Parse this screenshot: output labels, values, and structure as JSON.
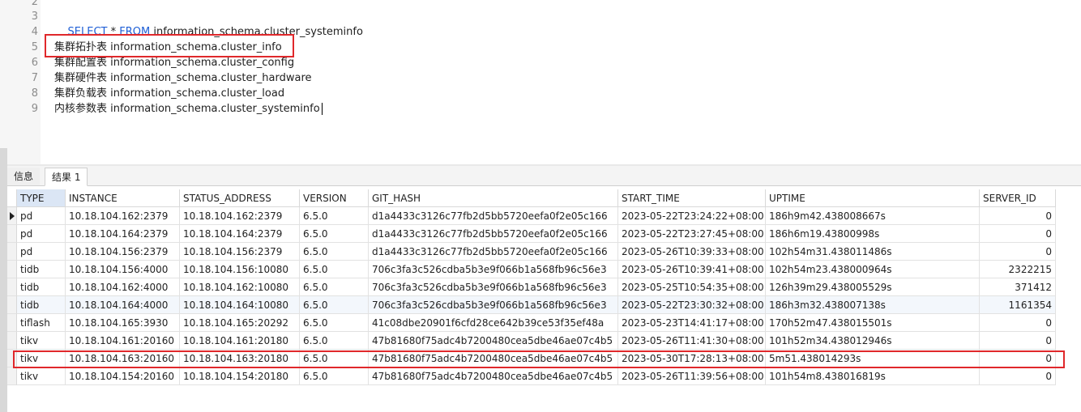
{
  "editor": {
    "lines": [
      {
        "num": "2",
        "text": ""
      },
      {
        "num": "3",
        "kw1": "SELECT",
        "mid": " * ",
        "kw2": "FROM",
        "rest": " information_schema.cluster_systeminfo"
      },
      {
        "num": "4",
        "text": ""
      },
      {
        "num": "5",
        "text": "集群拓扑表 information_schema.cluster_info"
      },
      {
        "num": "6",
        "text": "集群配置表 information_schema.cluster_config"
      },
      {
        "num": "7",
        "text": "集群硬件表 information_schema.cluster_hardware"
      },
      {
        "num": "8",
        "text": "集群负载表 information_schema.cluster_load"
      },
      {
        "num": "9",
        "text": "内核参数表 information_schema.cluster_systeminfo"
      }
    ]
  },
  "tabs": {
    "info": "信息",
    "result": "结果 1"
  },
  "table": {
    "columns": [
      "TYPE",
      "INSTANCE",
      "STATUS_ADDRESS",
      "VERSION",
      "GIT_HASH",
      "START_TIME",
      "UPTIME",
      "SERVER_ID"
    ],
    "rows": [
      [
        "pd",
        "10.18.104.162:2379",
        "10.18.104.162:2379",
        "6.5.0",
        "d1a4433c3126c77fb2d5bb5720eefa0f2e05c166",
        "2023-05-22T23:24:22+08:00",
        "186h9m42.438008667s",
        "0"
      ],
      [
        "pd",
        "10.18.104.164:2379",
        "10.18.104.164:2379",
        "6.5.0",
        "d1a4433c3126c77fb2d5bb5720eefa0f2e05c166",
        "2023-05-22T23:27:45+08:00",
        "186h6m19.43800998s",
        "0"
      ],
      [
        "pd",
        "10.18.104.156:2379",
        "10.18.104.156:2379",
        "6.5.0",
        "d1a4433c3126c77fb2d5bb5720eefa0f2e05c166",
        "2023-05-26T10:39:33+08:00",
        "102h54m31.438011486s",
        "0"
      ],
      [
        "tidb",
        "10.18.104.156:4000",
        "10.18.104.156:10080",
        "6.5.0",
        "706c3fa3c526cdba5b3e9f066b1a568fb96c56e3",
        "2023-05-26T10:39:41+08:00",
        "102h54m23.438000964s",
        "2322215"
      ],
      [
        "tidb",
        "10.18.104.162:4000",
        "10.18.104.162:10080",
        "6.5.0",
        "706c3fa3c526cdba5b3e9f066b1a568fb96c56e3",
        "2023-05-25T10:54:35+08:00",
        "126h39m29.438005529s",
        "371412"
      ],
      [
        "tidb",
        "10.18.104.164:4000",
        "10.18.104.164:10080",
        "6.5.0",
        "706c3fa3c526cdba5b3e9f066b1a568fb96c56e3",
        "2023-05-22T23:30:32+08:00",
        "186h3m32.438007138s",
        "1161354"
      ],
      [
        "tiflash",
        "10.18.104.165:3930",
        "10.18.104.165:20292",
        "6.5.0",
        "41c08dbe20901f6cfd28ce642b39ce53f35ef48a",
        "2023-05-23T14:41:17+08:00",
        "170h52m47.438015501s",
        "0"
      ],
      [
        "tikv",
        "10.18.104.161:20160",
        "10.18.104.161:20180",
        "6.5.0",
        "47b81680f75adc4b7200480cea5dbe46ae07c4b5",
        "2023-05-26T11:41:30+08:00",
        "101h52m34.438012946s",
        "0"
      ],
      [
        "tikv",
        "10.18.104.163:20160",
        "10.18.104.163:20180",
        "6.5.0",
        "47b81680f75adc4b7200480cea5dbe46ae07c4b5",
        "2023-05-30T17:28:13+08:00",
        "5m51.438014293s",
        "0"
      ],
      [
        "tikv",
        "10.18.104.154:20160",
        "10.18.104.154:20180",
        "6.5.0",
        "47b81680f75adc4b7200480cea5dbe46ae07c4b5",
        "2023-05-26T11:39:56+08:00",
        "101h54m8.438016819s",
        "0"
      ]
    ]
  },
  "colors": {
    "keyword": "#1f5fd6",
    "highlight_box": "#e0282b",
    "selected_header": "#dbe6f5"
  }
}
